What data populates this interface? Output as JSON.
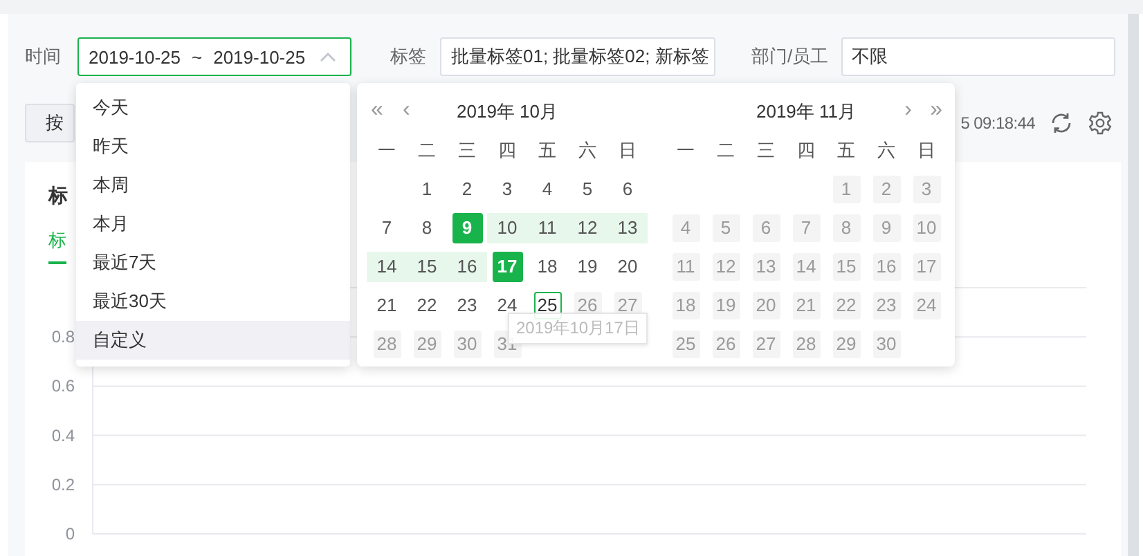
{
  "filters": {
    "time_label": "时间",
    "time_field": {
      "start": "2019-10-25",
      "separator": "~",
      "end": "2019-10-25",
      "open": true
    },
    "tag_label": "标签",
    "tag_value": "批量标签01; 批量标签02; 新标签",
    "dept_label": "部门/员工",
    "dept_value": "不限"
  },
  "toolbar": {
    "group_button": "按",
    "updated_time": "5 09:18:44"
  },
  "card": {
    "title": "标",
    "tabs": [
      {
        "label": "标",
        "selected": true
      }
    ],
    "y_axis_labels": [
      "0.8",
      "0.6",
      "0.4",
      "0.2",
      "0"
    ]
  },
  "shortcuts": [
    {
      "label": "今天",
      "selected": false
    },
    {
      "label": "昨天",
      "selected": false
    },
    {
      "label": "本周",
      "selected": false
    },
    {
      "label": "本月",
      "selected": false
    },
    {
      "label": "最近7天",
      "selected": false
    },
    {
      "label": "最近30天",
      "selected": false
    },
    {
      "label": "自定义",
      "selected": true
    }
  ],
  "calendar": {
    "prev_year": "«",
    "prev_month": "‹",
    "next_month": "›",
    "next_year": "»",
    "tooltip": "2019年10月17日",
    "months": [
      {
        "title": "2019年 10月",
        "weekdays": [
          "一",
          "二",
          "三",
          "四",
          "五",
          "六",
          "日"
        ],
        "weeks": [
          [
            {
              "kind": "blank"
            },
            {
              "d": "1",
              "kind": "normal"
            },
            {
              "d": "2",
              "kind": "normal"
            },
            {
              "d": "3",
              "kind": "normal"
            },
            {
              "d": "4",
              "kind": "normal"
            },
            {
              "d": "5",
              "kind": "normal"
            },
            {
              "d": "6",
              "kind": "normal"
            }
          ],
          [
            {
              "d": "7",
              "kind": "normal"
            },
            {
              "d": "8",
              "kind": "normal"
            },
            {
              "d": "9",
              "kind": "start"
            },
            {
              "d": "10",
              "kind": "range"
            },
            {
              "d": "11",
              "kind": "range"
            },
            {
              "d": "12",
              "kind": "range"
            },
            {
              "d": "13",
              "kind": "range"
            }
          ],
          [
            {
              "d": "14",
              "kind": "range"
            },
            {
              "d": "15",
              "kind": "range"
            },
            {
              "d": "16",
              "kind": "range"
            },
            {
              "d": "17",
              "kind": "end"
            },
            {
              "d": "18",
              "kind": "normal"
            },
            {
              "d": "19",
              "kind": "normal"
            },
            {
              "d": "20",
              "kind": "normal"
            }
          ],
          [
            {
              "d": "21",
              "kind": "normal"
            },
            {
              "d": "22",
              "kind": "normal"
            },
            {
              "d": "23",
              "kind": "normal"
            },
            {
              "d": "24",
              "kind": "normal"
            },
            {
              "d": "25",
              "kind": "today"
            },
            {
              "d": "26",
              "kind": "disabled"
            },
            {
              "d": "27",
              "kind": "disabled"
            }
          ],
          [
            {
              "d": "28",
              "kind": "disabled"
            },
            {
              "d": "29",
              "kind": "disabled"
            },
            {
              "d": "30",
              "kind": "disabled"
            },
            {
              "d": "31",
              "kind": "disabled"
            }
          ]
        ]
      },
      {
        "title": "2019年 11月",
        "weekdays": [
          "一",
          "二",
          "三",
          "四",
          "五",
          "六",
          "日"
        ],
        "weeks": [
          [
            {
              "kind": "blank"
            },
            {
              "kind": "blank"
            },
            {
              "kind": "blank"
            },
            {
              "kind": "blank"
            },
            {
              "d": "1",
              "kind": "disabled"
            },
            {
              "d": "2",
              "kind": "disabled"
            },
            {
              "d": "3",
              "kind": "disabled"
            }
          ],
          [
            {
              "d": "4",
              "kind": "disabled"
            },
            {
              "d": "5",
              "kind": "disabled"
            },
            {
              "d": "6",
              "kind": "disabled"
            },
            {
              "d": "7",
              "kind": "disabled"
            },
            {
              "d": "8",
              "kind": "disabled"
            },
            {
              "d": "9",
              "kind": "disabled"
            },
            {
              "d": "10",
              "kind": "disabled"
            }
          ],
          [
            {
              "d": "11",
              "kind": "disabled"
            },
            {
              "d": "12",
              "kind": "disabled"
            },
            {
              "d": "13",
              "kind": "disabled"
            },
            {
              "d": "14",
              "kind": "disabled"
            },
            {
              "d": "15",
              "kind": "disabled"
            },
            {
              "d": "16",
              "kind": "disabled"
            },
            {
              "d": "17",
              "kind": "disabled"
            }
          ],
          [
            {
              "d": "18",
              "kind": "disabled"
            },
            {
              "d": "19",
              "kind": "disabled"
            },
            {
              "d": "20",
              "kind": "disabled"
            },
            {
              "d": "21",
              "kind": "disabled"
            },
            {
              "d": "22",
              "kind": "disabled"
            },
            {
              "d": "23",
              "kind": "disabled"
            },
            {
              "d": "24",
              "kind": "disabled"
            }
          ],
          [
            {
              "d": "25",
              "kind": "disabled"
            },
            {
              "d": "26",
              "kind": "disabled"
            },
            {
              "d": "27",
              "kind": "disabled"
            },
            {
              "d": "28",
              "kind": "disabled"
            },
            {
              "d": "29",
              "kind": "disabled"
            },
            {
              "d": "30",
              "kind": "disabled"
            }
          ]
        ]
      }
    ]
  }
}
